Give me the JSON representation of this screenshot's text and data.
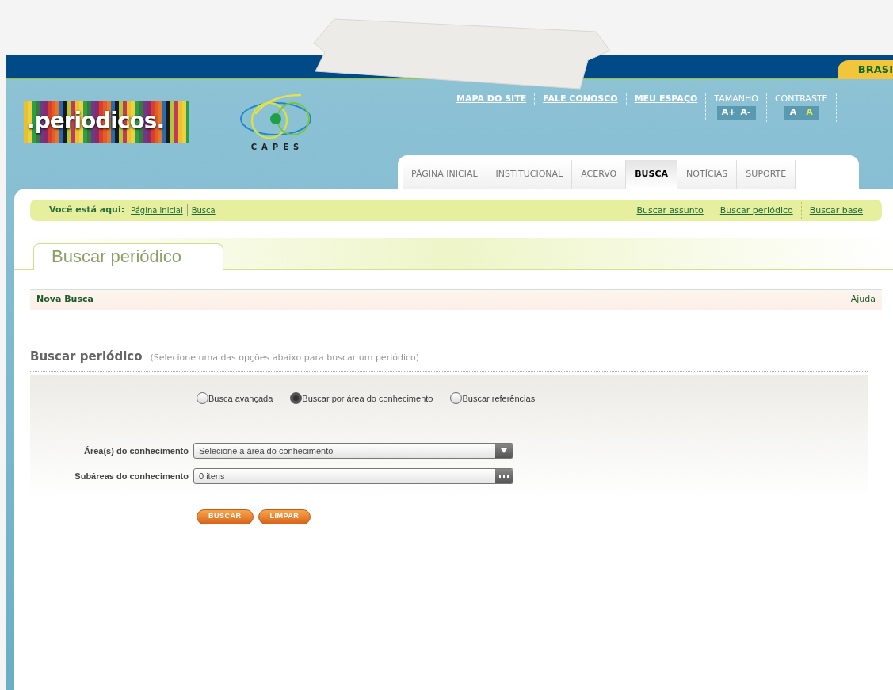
{
  "top_bar": {
    "badge": "BRASI"
  },
  "header": {
    "logo_text": ".periodicos.",
    "capes_text": "CAPES",
    "utility_links": [
      "MAPA DO SITE",
      "FALE CONOSCO",
      "MEU ESPAÇO"
    ],
    "font_size": {
      "label": "TAMANHO",
      "buttons": [
        "A+",
        "A-"
      ]
    },
    "contrast": {
      "label": "CONTRASTE",
      "options": [
        {
          "label": "A",
          "kind": "normal"
        },
        {
          "label": "A",
          "kind": "high_contrast"
        }
      ]
    }
  },
  "tabs": [
    {
      "label": "PÁGINA INICIAL",
      "selected": false
    },
    {
      "label": "INSTITUCIONAL",
      "selected": false
    },
    {
      "label": "ACERVO",
      "selected": false
    },
    {
      "label": "BUSCA",
      "selected": true
    },
    {
      "label": "NOTÍCIAS",
      "selected": false
    },
    {
      "label": "SUPORTE",
      "selected": false
    }
  ],
  "breadcrumb": {
    "label": "Você está aqui:",
    "items": [
      "Página inicial",
      "Busca"
    ],
    "shortcuts": [
      "Buscar assunto",
      "Buscar periódico",
      "Buscar base"
    ]
  },
  "page_title": "Buscar periódico",
  "action_bar": {
    "left": "Nova Busca",
    "right": "Ajuda"
  },
  "section": {
    "title": "Buscar periódico",
    "hint": "(Selecione uma das opções abaixo para buscar um periódico)"
  },
  "search_modes": [
    {
      "label": "Busca avançada",
      "selected": false
    },
    {
      "label": "Buscar por área do conhecimento",
      "selected": true
    },
    {
      "label": "Buscar referências",
      "selected": false
    }
  ],
  "fields": [
    {
      "label": "Área(s) do conhecimento",
      "value": "Selecione a área do conhecimento",
      "kind": "dropdown"
    },
    {
      "label": "Subáreas do conhecimento",
      "value": "0 itens",
      "kind": "picker"
    }
  ],
  "buttons": [
    "BUSCAR",
    "LIMPAR"
  ]
}
